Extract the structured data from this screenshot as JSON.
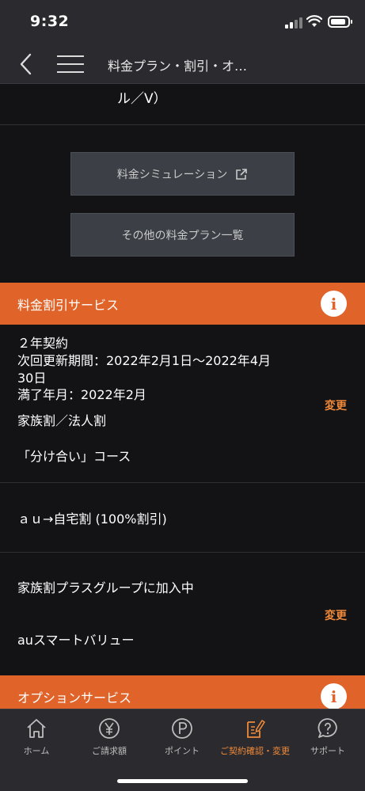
{
  "status_bar": {
    "time": "9:32"
  },
  "nav": {
    "title": "料金プラン・割引・オ…"
  },
  "plan": {
    "fragment": "ル／V）",
    "simulation_label": "料金シミュレーション",
    "other_plans_label": "その他の料金プラン一覧"
  },
  "discount_section": {
    "title": "料金割引サービス",
    "info_icon": "i",
    "contract_name": "２年契約",
    "renewal_line1": "次回更新期間：2022年2月1日～2022年4月",
    "renewal_line2": "30日",
    "expiry": "満了年月：2022年2月",
    "family_discount": "家族割／法人割",
    "course": "「分け合い」コース",
    "change_label_1": "変更",
    "home_discount": "ａｕ→自宅割 (100%割引)",
    "family_plus_group": "家族割プラスグループに加入中",
    "smart_value": "auスマートバリュー",
    "change_label_2": "変更"
  },
  "option_section": {
    "title": "オプションサービス",
    "info_icon": "i"
  },
  "tabbar": {
    "items": [
      {
        "label": "ホーム",
        "icon": "home-icon",
        "active": false
      },
      {
        "label": "ご請求額",
        "icon": "yen-icon",
        "active": false
      },
      {
        "label": "ポイント",
        "icon": "point-icon",
        "active": false
      },
      {
        "label": "ご契約確認・変更",
        "icon": "contract-edit-icon",
        "active": true
      },
      {
        "label": "サポート",
        "icon": "support-icon",
        "active": false
      }
    ]
  },
  "colors": {
    "accent": "#e0642a",
    "accent_text": "#f08a3a",
    "background": "#131316",
    "bar": "#2b2b2f",
    "button": "#3c4046"
  }
}
